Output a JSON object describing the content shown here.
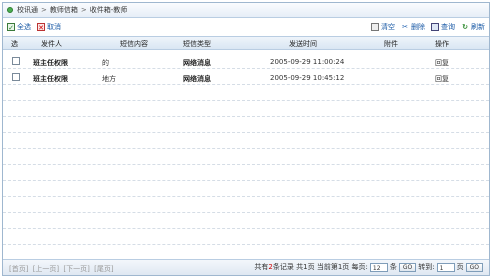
{
  "breadcrumb": [
    "校讯通",
    "教师信箱",
    "收件箱-教师"
  ],
  "breadcrumb_sep": ">",
  "toolbar": {
    "select_all": "全选",
    "cancel": "取消",
    "clear": "清空",
    "delete": "删除",
    "query": "查询",
    "refresh": "刷新"
  },
  "table": {
    "headers": [
      "选",
      "发件人",
      "短信内容",
      "短信类型",
      "发送时间",
      "附件",
      "操作"
    ],
    "rows": [
      {
        "sender": "班主任权限",
        "content": "的",
        "type": "网络消息",
        "time": "2005-09-29 11:00:24",
        "attachment": "",
        "action": "回复"
      },
      {
        "sender": "班主任权限",
        "content": "地方",
        "type": "网络消息",
        "time": "2005-09-29 10:45:12",
        "attachment": "",
        "action": "回复"
      }
    ]
  },
  "pager": {
    "first": "[首页]",
    "prev": "[上一页]",
    "next": "[下一页]",
    "last": "[尾页]",
    "total_prefix": "共有",
    "total_count": "2",
    "total_suffix": "条记录",
    "pages_prefix": "共",
    "pages_count": "1",
    "pages_suffix": "页",
    "current_prefix": "当前第",
    "current_page": "1",
    "current_suffix": "页",
    "per_page_label": "每页:",
    "per_page_value": "12",
    "per_page_unit": "条",
    "go_label": "GO",
    "goto_label": "转到:",
    "goto_value": "1",
    "goto_unit": "页"
  }
}
